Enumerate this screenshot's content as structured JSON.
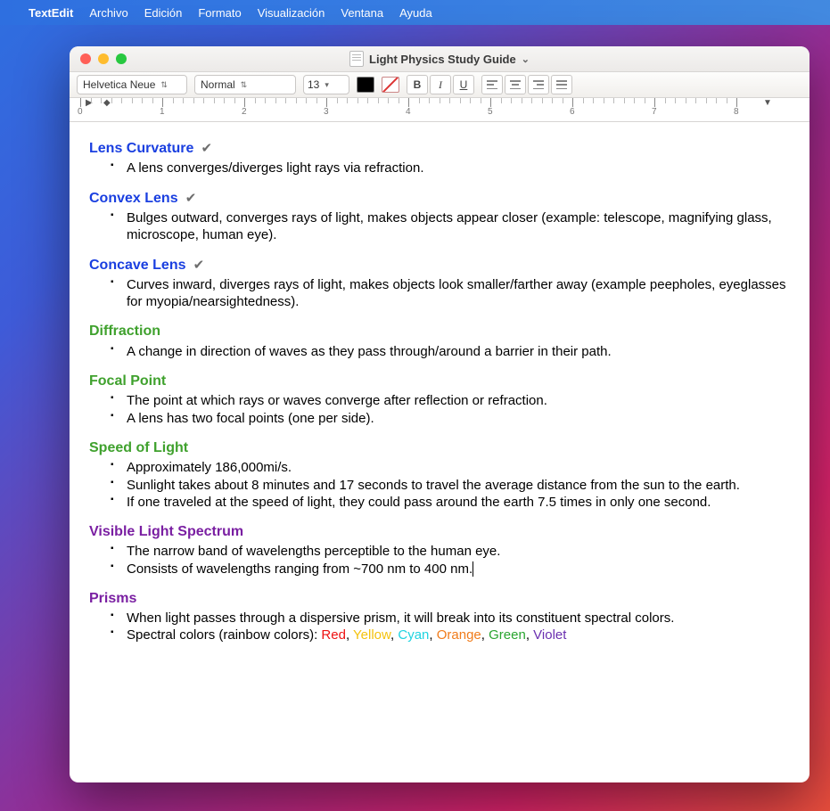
{
  "menubar": {
    "app": "TextEdit",
    "items": [
      "Archivo",
      "Edición",
      "Formato",
      "Visualización",
      "Ventana",
      "Ayuda"
    ]
  },
  "window": {
    "title": "Light Physics Study Guide"
  },
  "toolbar": {
    "font": "Helvetica Neue",
    "style": "Normal",
    "size": "13",
    "bold": "B",
    "italic": "I",
    "underline": "U"
  },
  "ruler": {
    "numbers": [
      "0",
      "1",
      "2",
      "3",
      "4",
      "5",
      "6",
      "7",
      "8"
    ]
  },
  "sections": [
    {
      "title": "Lens Curvature",
      "color": "blue",
      "check": true,
      "bullets": [
        "A lens converges/diverges light rays via refraction."
      ]
    },
    {
      "title": "Convex Lens",
      "color": "blue",
      "check": true,
      "bullets": [
        "Bulges outward, converges rays of light, makes objects appear closer (example: telescope, magnifying glass, microscope, human eye)."
      ]
    },
    {
      "title": "Concave Lens",
      "color": "blue",
      "check": true,
      "bullets": [
        "Curves inward, diverges rays of light, makes objects look smaller/farther away (example peepholes, eyeglasses for myopia/nearsightedness)."
      ]
    },
    {
      "title": "Diffraction",
      "color": "green",
      "check": false,
      "bullets": [
        "A change in direction of waves as they pass through/around a barrier in their path."
      ]
    },
    {
      "title": "Focal Point",
      "color": "green",
      "check": false,
      "bullets": [
        "The point at which rays or waves converge after reflection or refraction.",
        "A lens has two focal points (one per side)."
      ]
    },
    {
      "title": "Speed of Light",
      "color": "green",
      "check": false,
      "bullets": [
        "Approximately 186,000mi/s.",
        "Sunlight takes about 8 minutes and 17 seconds to travel the average distance from the sun to the earth.",
        "If one traveled at the speed of light, they could pass around the earth 7.5 times in only one second."
      ]
    },
    {
      "title": "Visible Light Spectrum",
      "color": "purple",
      "check": false,
      "bullets": [
        "The narrow band of wavelengths perceptible to the human eye.",
        "Consists of wavelengths ranging from ~700 nm to 400 nm."
      ],
      "caret_on_last": true
    },
    {
      "title": "Prisms",
      "color": "purple",
      "check": false,
      "bullets": [
        "When light passes through a dispersive prism, it will break into its constituent spectral colors."
      ],
      "special_bullet": {
        "prefix": "Spectral colors (rainbow colors): ",
        "colors": [
          {
            "text": "Red",
            "css": "#e11"
          },
          {
            "text": "Yellow",
            "css": "#f4c20d"
          },
          {
            "text": "Cyan",
            "css": "#1fd3e0"
          },
          {
            "text": "Orange",
            "css": "#f07b1a"
          },
          {
            "text": "Green",
            "css": "#29a52f"
          },
          {
            "text": "Violet",
            "css": "#6a2fb0"
          }
        ],
        "sep": ", "
      }
    }
  ],
  "checkmark": "✔"
}
